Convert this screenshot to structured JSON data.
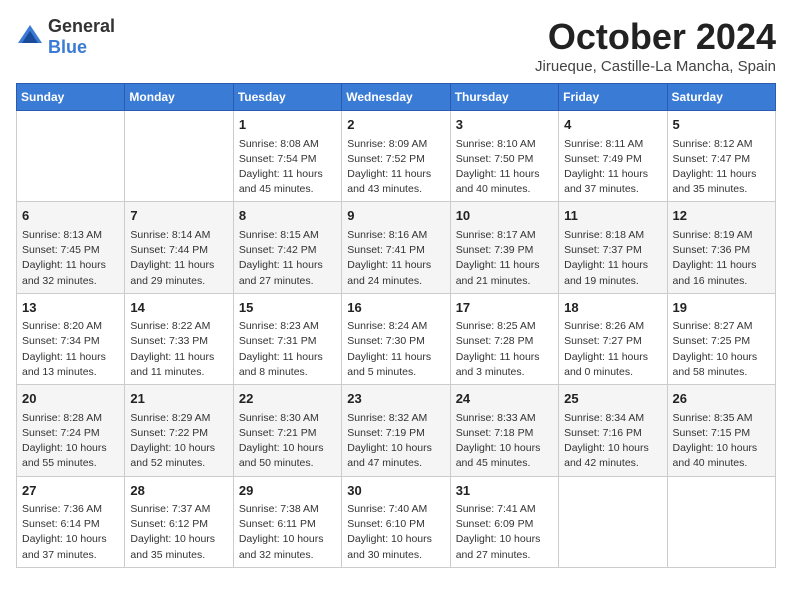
{
  "header": {
    "logo": {
      "general": "General",
      "blue": "Blue"
    },
    "title": "October 2024",
    "location": "Jirueque, Castille-La Mancha, Spain"
  },
  "calendar": {
    "weekdays": [
      "Sunday",
      "Monday",
      "Tuesday",
      "Wednesday",
      "Thursday",
      "Friday",
      "Saturday"
    ],
    "weeks": [
      [
        {
          "day": "",
          "detail": ""
        },
        {
          "day": "",
          "detail": ""
        },
        {
          "day": "1",
          "detail": "Sunrise: 8:08 AM\nSunset: 7:54 PM\nDaylight: 11 hours and 45 minutes."
        },
        {
          "day": "2",
          "detail": "Sunrise: 8:09 AM\nSunset: 7:52 PM\nDaylight: 11 hours and 43 minutes."
        },
        {
          "day": "3",
          "detail": "Sunrise: 8:10 AM\nSunset: 7:50 PM\nDaylight: 11 hours and 40 minutes."
        },
        {
          "day": "4",
          "detail": "Sunrise: 8:11 AM\nSunset: 7:49 PM\nDaylight: 11 hours and 37 minutes."
        },
        {
          "day": "5",
          "detail": "Sunrise: 8:12 AM\nSunset: 7:47 PM\nDaylight: 11 hours and 35 minutes."
        }
      ],
      [
        {
          "day": "6",
          "detail": "Sunrise: 8:13 AM\nSunset: 7:45 PM\nDaylight: 11 hours and 32 minutes."
        },
        {
          "day": "7",
          "detail": "Sunrise: 8:14 AM\nSunset: 7:44 PM\nDaylight: 11 hours and 29 minutes."
        },
        {
          "day": "8",
          "detail": "Sunrise: 8:15 AM\nSunset: 7:42 PM\nDaylight: 11 hours and 27 minutes."
        },
        {
          "day": "9",
          "detail": "Sunrise: 8:16 AM\nSunset: 7:41 PM\nDaylight: 11 hours and 24 minutes."
        },
        {
          "day": "10",
          "detail": "Sunrise: 8:17 AM\nSunset: 7:39 PM\nDaylight: 11 hours and 21 minutes."
        },
        {
          "day": "11",
          "detail": "Sunrise: 8:18 AM\nSunset: 7:37 PM\nDaylight: 11 hours and 19 minutes."
        },
        {
          "day": "12",
          "detail": "Sunrise: 8:19 AM\nSunset: 7:36 PM\nDaylight: 11 hours and 16 minutes."
        }
      ],
      [
        {
          "day": "13",
          "detail": "Sunrise: 8:20 AM\nSunset: 7:34 PM\nDaylight: 11 hours and 13 minutes."
        },
        {
          "day": "14",
          "detail": "Sunrise: 8:22 AM\nSunset: 7:33 PM\nDaylight: 11 hours and 11 minutes."
        },
        {
          "day": "15",
          "detail": "Sunrise: 8:23 AM\nSunset: 7:31 PM\nDaylight: 11 hours and 8 minutes."
        },
        {
          "day": "16",
          "detail": "Sunrise: 8:24 AM\nSunset: 7:30 PM\nDaylight: 11 hours and 5 minutes."
        },
        {
          "day": "17",
          "detail": "Sunrise: 8:25 AM\nSunset: 7:28 PM\nDaylight: 11 hours and 3 minutes."
        },
        {
          "day": "18",
          "detail": "Sunrise: 8:26 AM\nSunset: 7:27 PM\nDaylight: 11 hours and 0 minutes."
        },
        {
          "day": "19",
          "detail": "Sunrise: 8:27 AM\nSunset: 7:25 PM\nDaylight: 10 hours and 58 minutes."
        }
      ],
      [
        {
          "day": "20",
          "detail": "Sunrise: 8:28 AM\nSunset: 7:24 PM\nDaylight: 10 hours and 55 minutes."
        },
        {
          "day": "21",
          "detail": "Sunrise: 8:29 AM\nSunset: 7:22 PM\nDaylight: 10 hours and 52 minutes."
        },
        {
          "day": "22",
          "detail": "Sunrise: 8:30 AM\nSunset: 7:21 PM\nDaylight: 10 hours and 50 minutes."
        },
        {
          "day": "23",
          "detail": "Sunrise: 8:32 AM\nSunset: 7:19 PM\nDaylight: 10 hours and 47 minutes."
        },
        {
          "day": "24",
          "detail": "Sunrise: 8:33 AM\nSunset: 7:18 PM\nDaylight: 10 hours and 45 minutes."
        },
        {
          "day": "25",
          "detail": "Sunrise: 8:34 AM\nSunset: 7:16 PM\nDaylight: 10 hours and 42 minutes."
        },
        {
          "day": "26",
          "detail": "Sunrise: 8:35 AM\nSunset: 7:15 PM\nDaylight: 10 hours and 40 minutes."
        }
      ],
      [
        {
          "day": "27",
          "detail": "Sunrise: 7:36 AM\nSunset: 6:14 PM\nDaylight: 10 hours and 37 minutes."
        },
        {
          "day": "28",
          "detail": "Sunrise: 7:37 AM\nSunset: 6:12 PM\nDaylight: 10 hours and 35 minutes."
        },
        {
          "day": "29",
          "detail": "Sunrise: 7:38 AM\nSunset: 6:11 PM\nDaylight: 10 hours and 32 minutes."
        },
        {
          "day": "30",
          "detail": "Sunrise: 7:40 AM\nSunset: 6:10 PM\nDaylight: 10 hours and 30 minutes."
        },
        {
          "day": "31",
          "detail": "Sunrise: 7:41 AM\nSunset: 6:09 PM\nDaylight: 10 hours and 27 minutes."
        },
        {
          "day": "",
          "detail": ""
        },
        {
          "day": "",
          "detail": ""
        }
      ]
    ]
  }
}
